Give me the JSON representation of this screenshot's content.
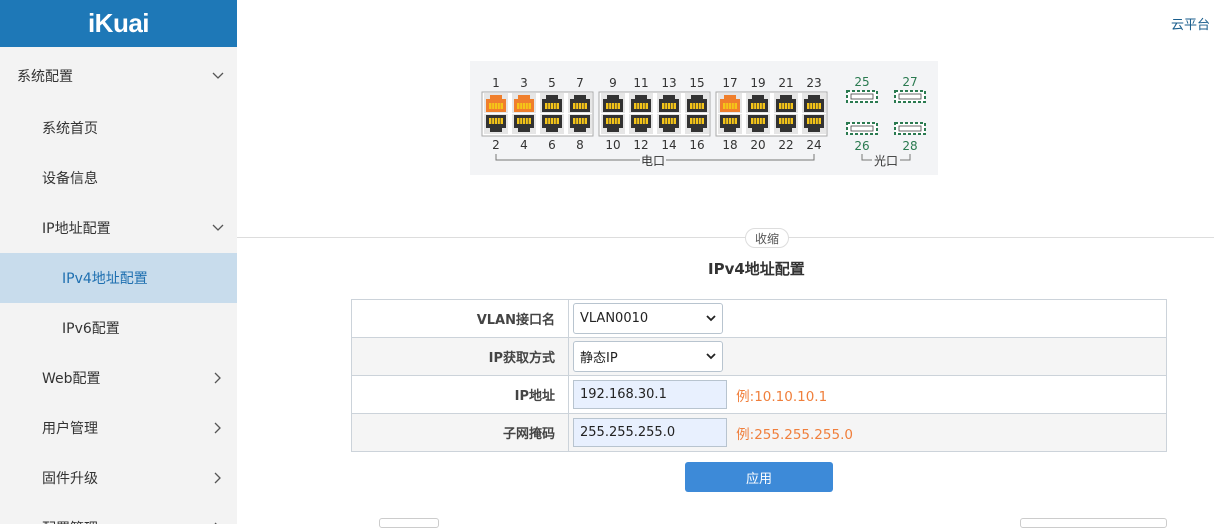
{
  "app": {
    "logo": "iKuai",
    "cloud_link": "云平台"
  },
  "sidebar": {
    "items": [
      {
        "label": "系统配置",
        "chevron": "chevron-down"
      },
      {
        "label": "系统首页"
      },
      {
        "label": "设备信息"
      },
      {
        "label": "IP地址配置",
        "chevron": "chevron-down"
      },
      {
        "label": "IPv4地址配置",
        "active": true
      },
      {
        "label": "IPv6配置"
      },
      {
        "label": "Web配置",
        "chevron": "chevron-right"
      },
      {
        "label": "用户管理",
        "chevron": "chevron-right"
      },
      {
        "label": "固件升级",
        "chevron": "chevron-right"
      },
      {
        "label": "配置管理",
        "chevron": "chevron-right"
      }
    ]
  },
  "switch_panel": {
    "top_ports": [
      "1",
      "3",
      "5",
      "7",
      "9",
      "11",
      "13",
      "15",
      "17",
      "19",
      "21",
      "23"
    ],
    "bottom_ports": [
      "2",
      "4",
      "6",
      "8",
      "10",
      "12",
      "14",
      "16",
      "18",
      "20",
      "22",
      "24"
    ],
    "active_ports": [
      "1",
      "3",
      "17"
    ],
    "sfp_top": [
      "25",
      "27"
    ],
    "sfp_bottom": [
      "26",
      "28"
    ],
    "electric_label": "电口",
    "optical_label": "光口",
    "colors": {
      "active_port": "#f07f2c",
      "inactive_port": "#333333",
      "pin": "#f5c518",
      "sfp": "#2a7a50"
    }
  },
  "collapse_label": "收缩",
  "form": {
    "title": "IPv4地址配置",
    "vlan_label": "VLAN接口名",
    "vlan_value": "VLAN0010",
    "ip_mode_label": "IP获取方式",
    "ip_mode_value": "静态IP",
    "ip_label": "IP地址",
    "ip_value": "192.168.30.1",
    "ip_hint": "例:10.10.10.1",
    "mask_label": "子网掩码",
    "mask_value": "255.255.255.0",
    "mask_hint": "例:255.255.255.0",
    "apply_label": "应用"
  },
  "colors": {
    "brand": "#1e78b7",
    "active_nav_bg": "#c8dcec",
    "apply_button": "#3d8ad8",
    "hint": "#f07f3c"
  }
}
